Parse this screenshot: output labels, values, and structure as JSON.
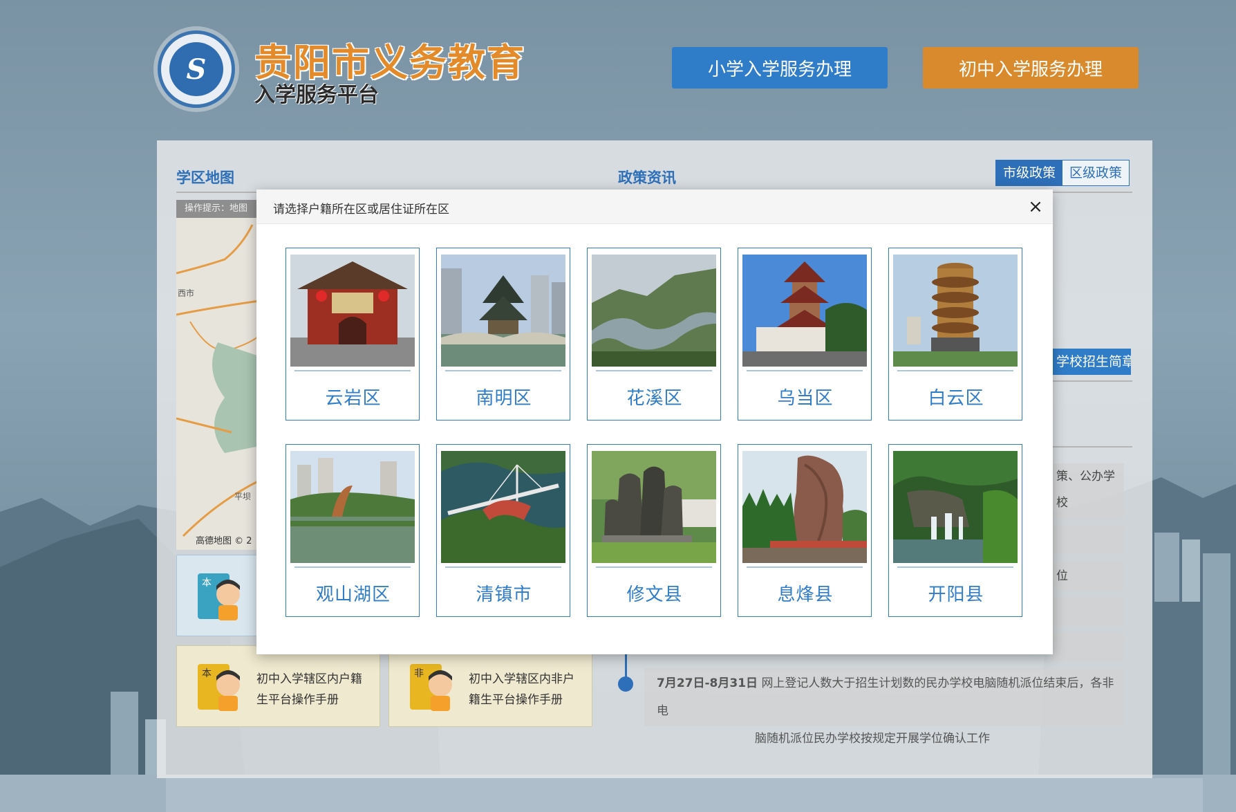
{
  "header": {
    "brand_title": "贵阳市义务教育",
    "brand_subtitle": "入学服务平台",
    "logo_text": "S",
    "btn_primary": "小学入学服务办理",
    "btn_middle": "初中入学服务办理"
  },
  "panel": {
    "map_title": "学区地图",
    "policy_title": "政策资讯",
    "tabs": [
      "市级政策",
      "区级政策"
    ],
    "map_hint": "操作提示：地图",
    "map_labels": [
      "西市",
      "平坝",
      "高德地图 © 2"
    ],
    "brochure_label": "学校招生简章",
    "right_snippets": [
      "策、公办学校",
      "位"
    ],
    "timeline": {
      "date": "7月27日-8月31日",
      "text_line1": "网上登记人数大于招生计划数的民办学校电脑随机派位结束后，各非电",
      "text_line2": "脑随机派位民办学校按规定开展学位确认工作"
    },
    "cards": [
      {
        "badge": "本",
        "label_line1": "初中入学辖区内户籍",
        "label_line2": "生平台操作手册"
      },
      {
        "badge": "非",
        "label_line1": "初中入学辖区内非户",
        "label_line2": "籍生平台操作手册"
      }
    ]
  },
  "modal": {
    "title": "请选择户籍所在区或居住证所在区",
    "close_icon": "×",
    "districts": [
      {
        "name": "云岩区",
        "photo": "arch-gate-photo"
      },
      {
        "name": "南明区",
        "photo": "jiaxiu-pavilion-photo"
      },
      {
        "name": "花溪区",
        "photo": "river-valley-photo"
      },
      {
        "name": "乌当区",
        "photo": "pagoda-tower-photo"
      },
      {
        "name": "白云区",
        "photo": "round-tower-photo"
      },
      {
        "name": "观山湖区",
        "photo": "lake-park-photo"
      },
      {
        "name": "清镇市",
        "photo": "bridge-lake-photo"
      },
      {
        "name": "修文县",
        "photo": "statue-group-photo"
      },
      {
        "name": "息烽县",
        "photo": "rock-monument-photo"
      },
      {
        "name": "开阳县",
        "photo": "waterfall-photo"
      }
    ]
  },
  "colors": {
    "primary_blue": "#2f7dc8",
    "accent_orange": "#d98a2c",
    "title_orange": "#e38b2b"
  }
}
